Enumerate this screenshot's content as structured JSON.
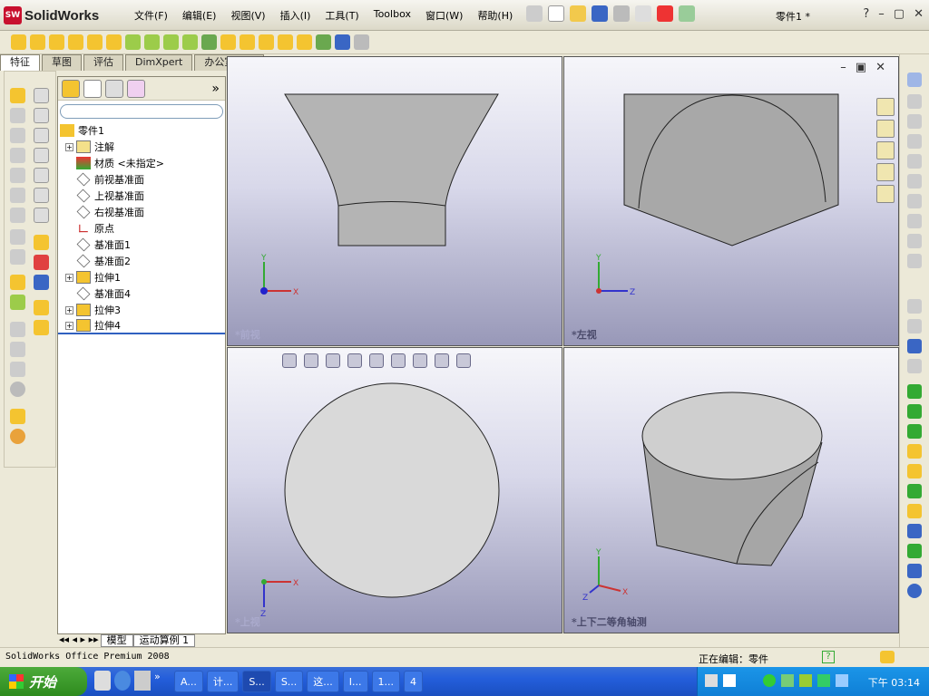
{
  "app": {
    "brand": "SolidWorks",
    "logo_text": "SW",
    "doc_title": "零件1 *"
  },
  "menu": [
    "文件(F)",
    "编辑(E)",
    "视图(V)",
    "插入(I)",
    "工具(T)",
    "Toolbox",
    "窗口(W)",
    "帮助(H)"
  ],
  "tabs": [
    {
      "label": "特征"
    },
    {
      "label": "草图"
    },
    {
      "label": "评估"
    },
    {
      "label": "DimXpert"
    },
    {
      "label": "办公室产品"
    }
  ],
  "feature_tree": {
    "root": "零件1",
    "items": [
      {
        "label": "注解",
        "expandable": true
      },
      {
        "label": "材质 <未指定>",
        "expandable": false
      },
      {
        "label": "前视基准面",
        "expandable": false
      },
      {
        "label": "上视基准面",
        "expandable": false
      },
      {
        "label": "右视基准面",
        "expandable": false
      },
      {
        "label": "原点",
        "expandable": false
      },
      {
        "label": "基准面1",
        "expandable": false
      },
      {
        "label": "基准面2",
        "expandable": false
      },
      {
        "label": "拉伸1",
        "expandable": true
      },
      {
        "label": "基准面4",
        "expandable": false
      },
      {
        "label": "拉伸3",
        "expandable": true
      },
      {
        "label": "拉伸4",
        "expandable": true
      }
    ],
    "collapse_label": "»",
    "plus": "+"
  },
  "bottom_tabs": [
    "模型",
    "运动算例 1"
  ],
  "viewports": [
    {
      "label": "*前视"
    },
    {
      "label": "*左视"
    },
    {
      "label": "*上视"
    },
    {
      "label": "*上下二等角轴测"
    }
  ],
  "axes": {
    "x": "X",
    "y": "Y",
    "z": "Z"
  },
  "status": {
    "left": "SolidWorks Office Premium 2008",
    "editing": "正在编辑：零件"
  },
  "taskbar": {
    "start": "开始",
    "items": [
      {
        "label": "A..."
      },
      {
        "label": "计..."
      },
      {
        "label": "S..."
      },
      {
        "label": "S..."
      },
      {
        "label": "这..."
      },
      {
        "label": "I..."
      },
      {
        "label": "1..."
      },
      {
        "label": "4"
      }
    ],
    "time": "下午 03:14"
  },
  "colors": {
    "accent": "#245edb",
    "brand": "#c8102e",
    "part": "#b4b4b4"
  }
}
